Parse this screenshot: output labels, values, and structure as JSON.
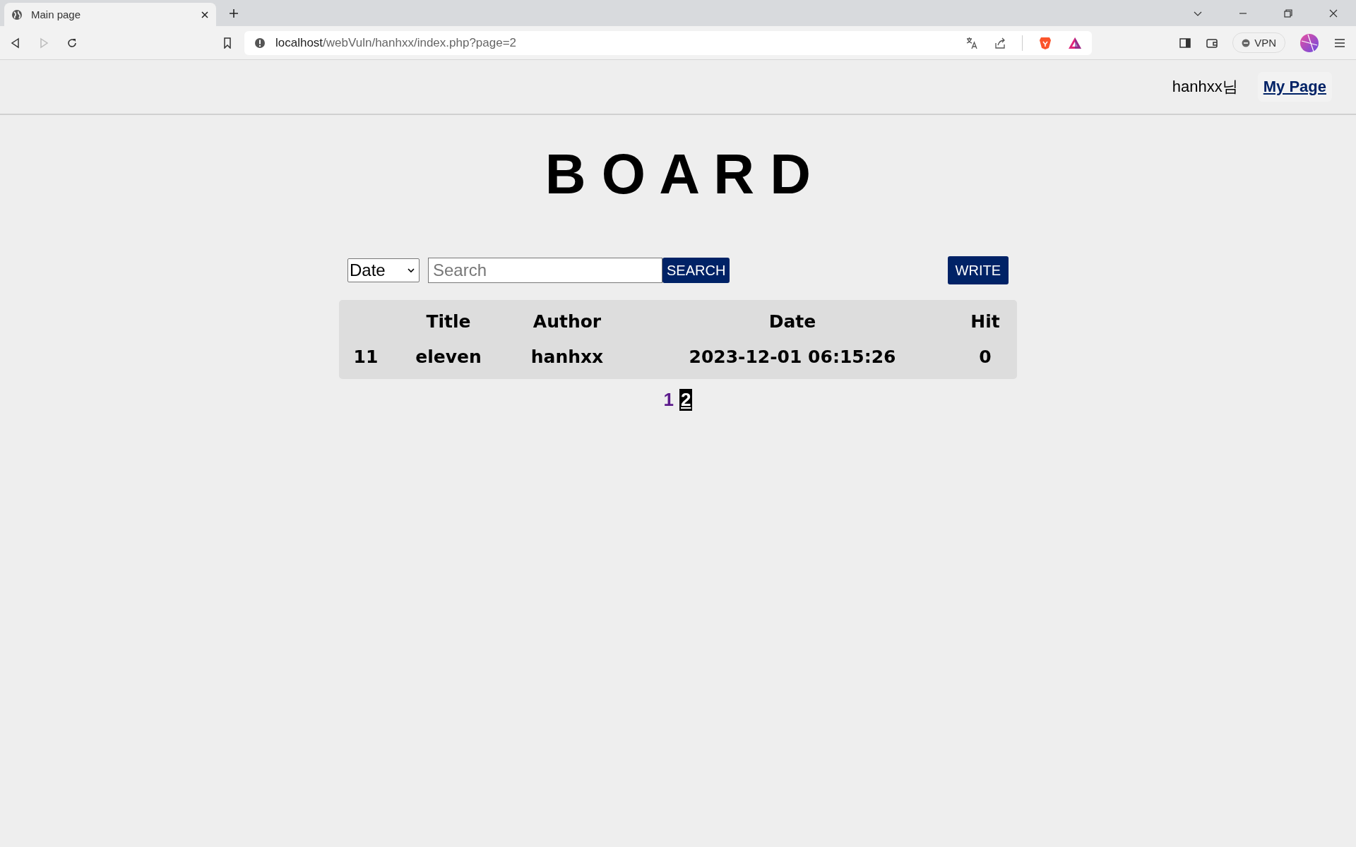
{
  "browser": {
    "tab_title": "Main page",
    "url_host": "localhost",
    "url_path": "/webVuln/hanhxx/index.php?page=2",
    "vpn_label": "VPN"
  },
  "header": {
    "user": "hanhxx님",
    "my_page_link": "My Page"
  },
  "title": "B O A R D",
  "search": {
    "field_select": "Date",
    "placeholder": "Search",
    "search_button": "SEARCH",
    "write_button": "WRITE"
  },
  "table": {
    "columns": [
      "",
      "Title",
      "Author",
      "Date",
      "Hit"
    ],
    "rows": [
      {
        "cells": [
          "11",
          "eleven",
          "hanhxx",
          "2023-12-01 06:15:26",
          "0"
        ]
      }
    ]
  },
  "pagination": [
    {
      "label": "1",
      "selected": false
    },
    {
      "label": "2",
      "selected": true
    }
  ]
}
